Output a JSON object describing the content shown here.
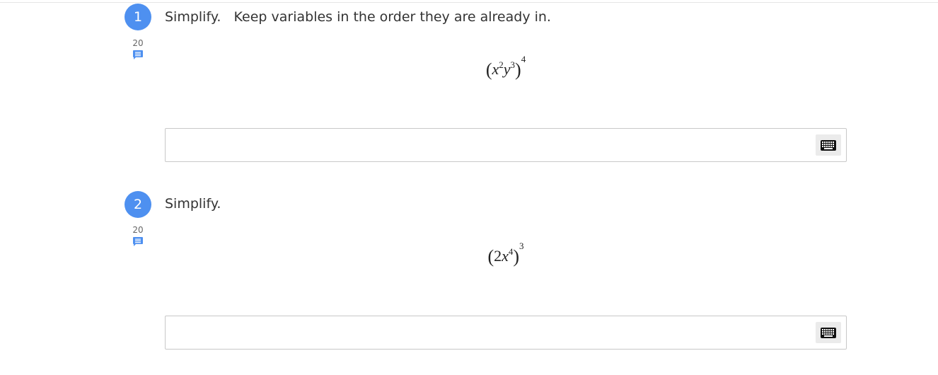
{
  "questions": [
    {
      "number": "1",
      "points": "20",
      "prompt": "Simplify.   Keep variables in the order they are already in.",
      "expression": {
        "open": "(",
        "base_1": "x",
        "exp_1": "2",
        "base_2": "y",
        "exp_2": "3",
        "close": ")",
        "outer_exp": "4"
      },
      "answer_value": ""
    },
    {
      "number": "2",
      "points": "20",
      "prompt": "Simplify.",
      "expression": {
        "open": "(",
        "coefficient": "2",
        "base_1": "x",
        "exp_1": "4",
        "close": ")",
        "outer_exp": "3"
      },
      "answer_value": ""
    }
  ],
  "icons": {
    "comment": "comment-icon",
    "keyboard": "keyboard-icon"
  },
  "colors": {
    "accent": "#4e90f0",
    "keyboard_button_bg": "#ebebeb",
    "input_border": "#c8c8c8"
  }
}
